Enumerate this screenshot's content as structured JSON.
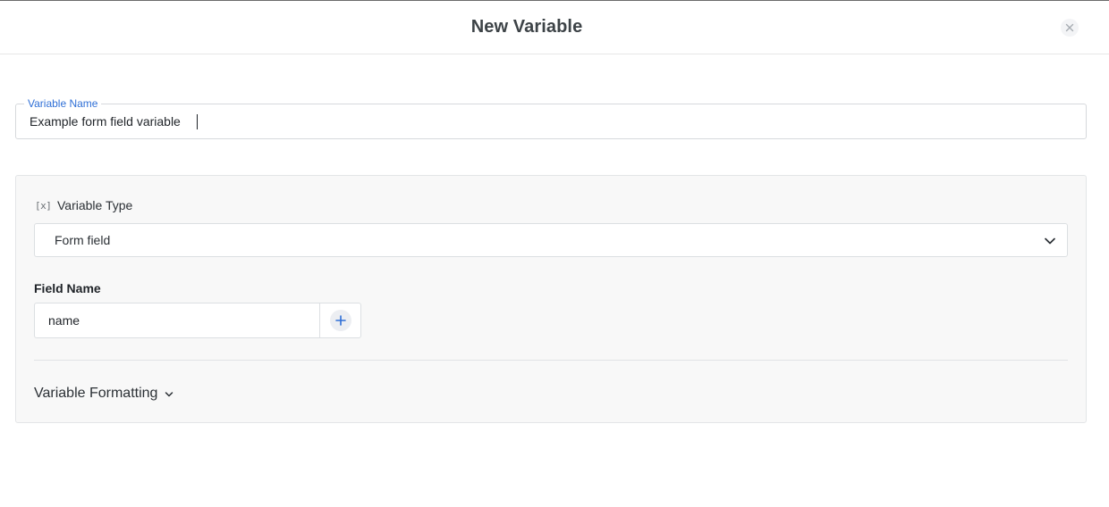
{
  "header": {
    "title": "New Variable"
  },
  "variable_name": {
    "label": "Variable Name",
    "value": "Example form field variable"
  },
  "variable_type": {
    "label": "Variable Type",
    "icon_text": "[x]",
    "selected": "Form field"
  },
  "field_name": {
    "label": "Field Name",
    "value": "name"
  },
  "formatting": {
    "label": "Variable Formatting"
  },
  "colors": {
    "accent": "#2f6fd6",
    "title": "#3d4347",
    "panel_bg": "#f8f8f8"
  },
  "icons": {
    "close": "close-icon",
    "chevron": "chevron-down-icon",
    "add": "plus-icon",
    "variable": "variable-icon"
  }
}
